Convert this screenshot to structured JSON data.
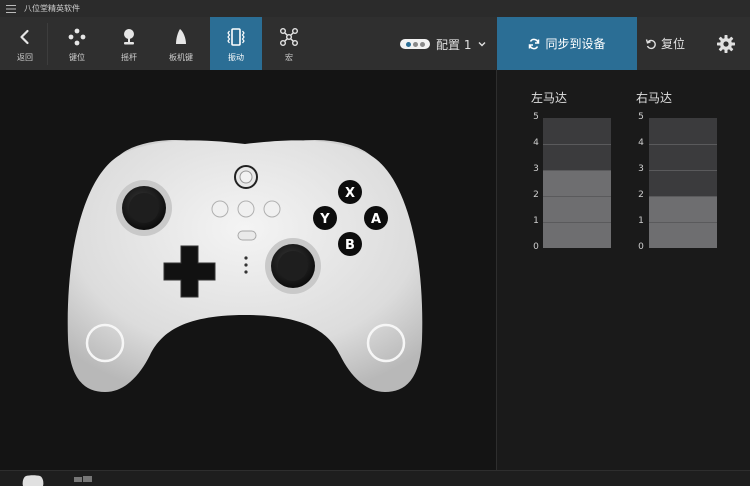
{
  "window": {
    "title": "八位堂精英软件"
  },
  "toolbar": {
    "back": "返回",
    "keys": "键位",
    "joystick": "摇杆",
    "trigger": "板机键",
    "vibration": "振动",
    "macro": "宏"
  },
  "profile": {
    "label": "配置 1"
  },
  "actions": {
    "sync": "同步到设备",
    "reset": "复位"
  },
  "motors": {
    "left": {
      "label": "左马达",
      "level": 3
    },
    "right": {
      "label": "右马达",
      "level": 2
    },
    "scale": [
      "5",
      "4",
      "3",
      "2",
      "1",
      "0"
    ]
  },
  "controller": {
    "face_buttons": [
      "X",
      "Y",
      "A",
      "B"
    ]
  },
  "colors": {
    "accent": "#2b6e95",
    "bar_filled": "#6e6e70",
    "bar_empty": "#3b3b3d"
  }
}
